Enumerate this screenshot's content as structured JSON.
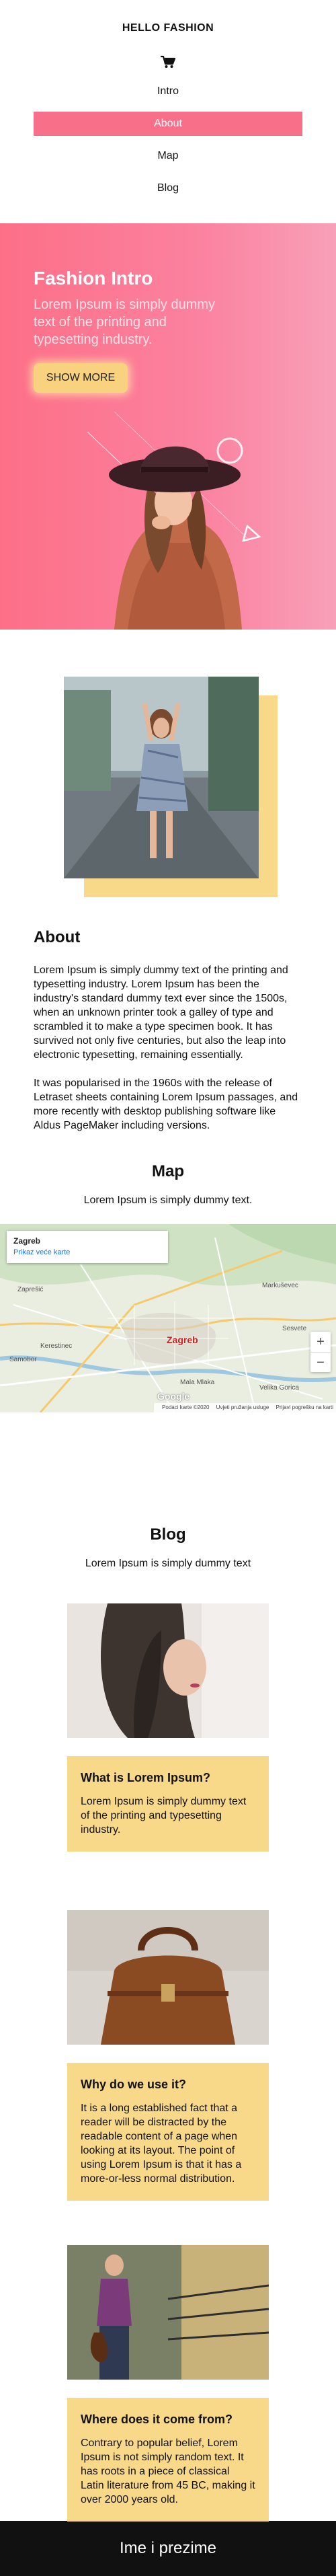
{
  "header": {
    "brand": "HELLO FASHION",
    "cart_icon": "shopping-cart-icon",
    "nav": [
      {
        "label": "Intro",
        "active": false
      },
      {
        "label": "About",
        "active": true
      },
      {
        "label": "Map",
        "active": false
      },
      {
        "label": "Blog",
        "active": false
      }
    ],
    "active_color": "#f86f8a"
  },
  "hero": {
    "title": "Fashion Intro",
    "subtitle": "Lorem Ipsum is simply dummy text of the printing and typesetting industry.",
    "button_label": "SHOW MORE",
    "button_color": "#f8d27e",
    "gradient": [
      "#fd6f87",
      "#f8a0b8"
    ]
  },
  "about": {
    "title": "About",
    "paragraphs": [
      "Lorem Ipsum is simply dummy text of the printing and typesetting industry. Lorem Ipsum has been the industry's standard dummy text ever since the 1500s, when an unknown printer took a galley of type and scrambled it to make a type specimen book. It has survived not only five centuries, but also the leap into electronic typesetting, remaining essentially.",
      "It was popularised in the 1960s with the release of Letraset sheets containing Lorem Ipsum passages, and more recently with desktop publishing software like Aldus PageMaker including versions."
    ],
    "accent_color": "#f8d98a"
  },
  "map": {
    "title": "Map",
    "subtitle": "Lorem Ipsum is simply dummy text.",
    "place_name": "Zagreb",
    "larger_map_link": "Prikaz veće karte",
    "city_label": "Zagreb",
    "provider": "Google",
    "footer_items": [
      "Podaci karte ©2020",
      "Uvjeti pružanja usluge",
      "Prijavi pogrešku na karti"
    ],
    "zoom_in": "+",
    "zoom_out": "−",
    "labels": [
      "Zaprešić",
      "Sesvete",
      "Samobor",
      "Markuševec",
      "Velika Gorica",
      "Kerestinec",
      "Mala Mlaka"
    ]
  },
  "blog": {
    "title": "Blog",
    "subtitle": "Lorem Ipsum is simply dummy text",
    "posts": [
      {
        "title": "What is Lorem Ipsum?",
        "text": "Lorem Ipsum is simply dummy text of the printing and typesetting industry."
      },
      {
        "title": "Why do we use it?",
        "text": "It is a long established fact that a reader will be distracted by the readable content of a page when looking at its layout. The point of using Lorem Ipsum is that it has a more-or-less normal distribution."
      },
      {
        "title": "Where does it come from?",
        "text": "Contrary to popular belief, Lorem Ipsum is not simply random text. It has roots in a piece of classical Latin literature from 45 BC, making it over 2000 years old."
      }
    ]
  },
  "footer": {
    "text": "Ime i prezime"
  }
}
